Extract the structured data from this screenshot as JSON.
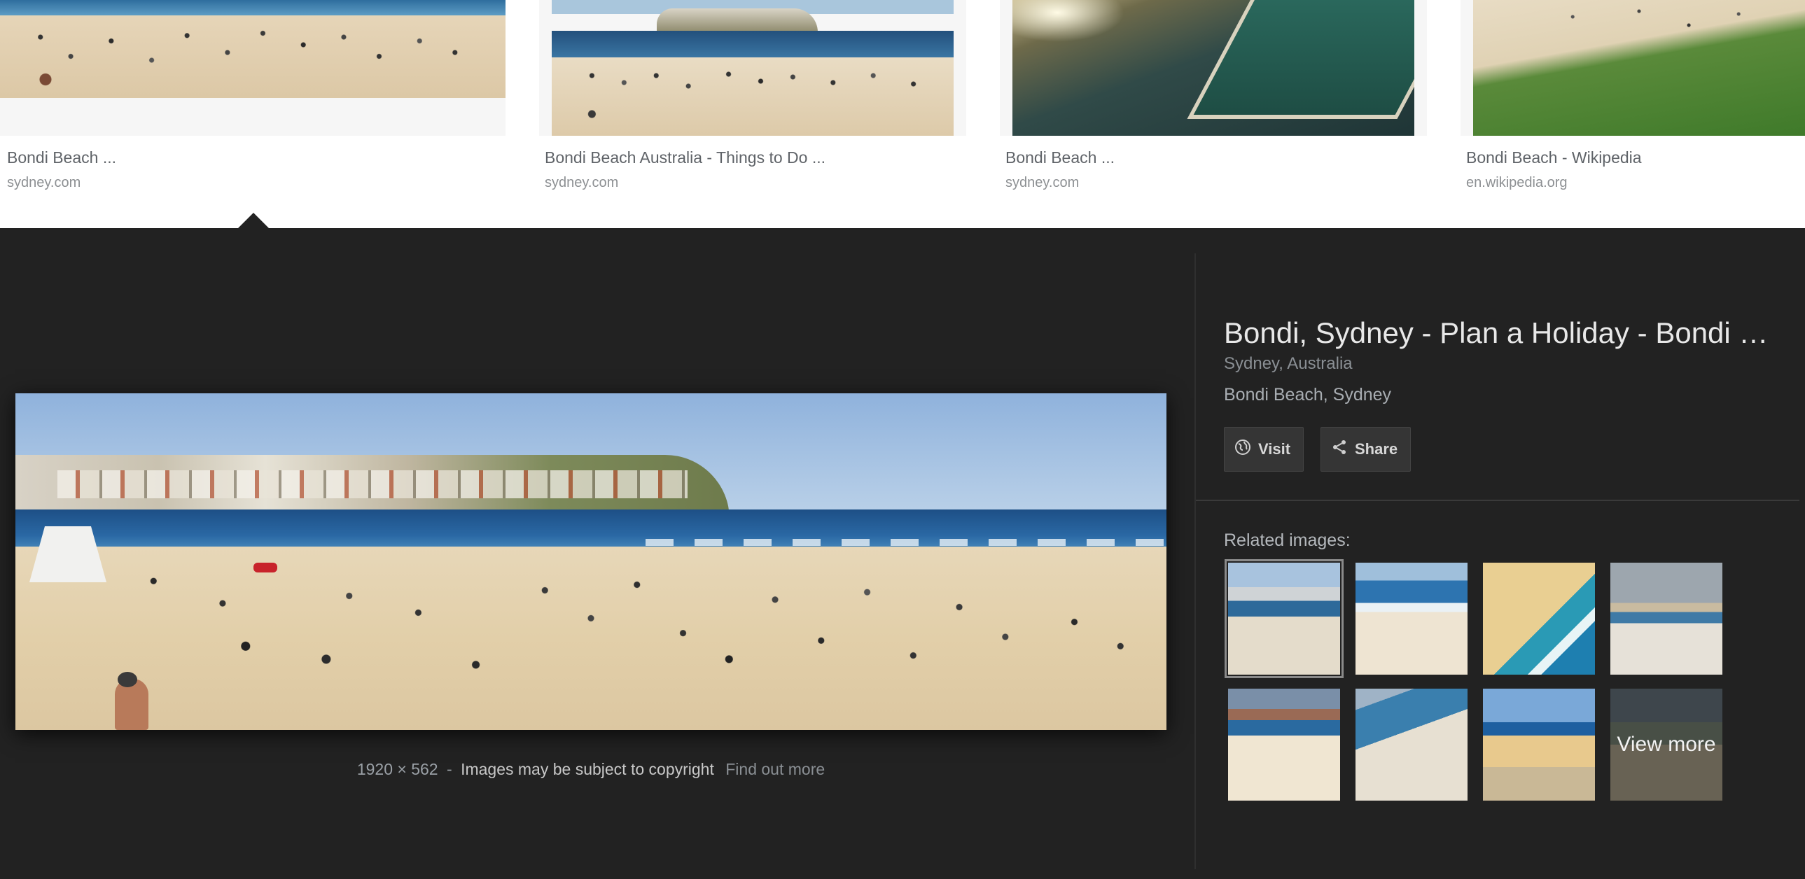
{
  "results": [
    {
      "title": "Bondi Beach ...",
      "site": "sydney.com"
    },
    {
      "title": "Bondi Beach Australia - Things to Do ...",
      "site": "sydney.com"
    },
    {
      "title": "Bondi Beach ...",
      "site": "sydney.com"
    },
    {
      "title": "Bondi Beach - Wikipedia",
      "site": "en.wikipedia.org"
    }
  ],
  "preview": {
    "dimensions": "1920 × 562",
    "separator": "-",
    "copyright": "Images may be subject to copyright",
    "find_out_more": "Find out more"
  },
  "side": {
    "title": "Bondi, Sydney - Plan a Holiday - Bondi Beach",
    "location": "Sydney, Australia",
    "caption": "Bondi Beach, Sydney",
    "visit_label": "Visit",
    "share_label": "Share",
    "related_label": "Related images:",
    "view_more_label": "View more"
  },
  "colors": {
    "panel_bg": "#222222",
    "caption_text": "#5f6368",
    "site_text": "#8d9093"
  },
  "icons": {
    "visit": "globe-icon",
    "share": "share-icon"
  }
}
